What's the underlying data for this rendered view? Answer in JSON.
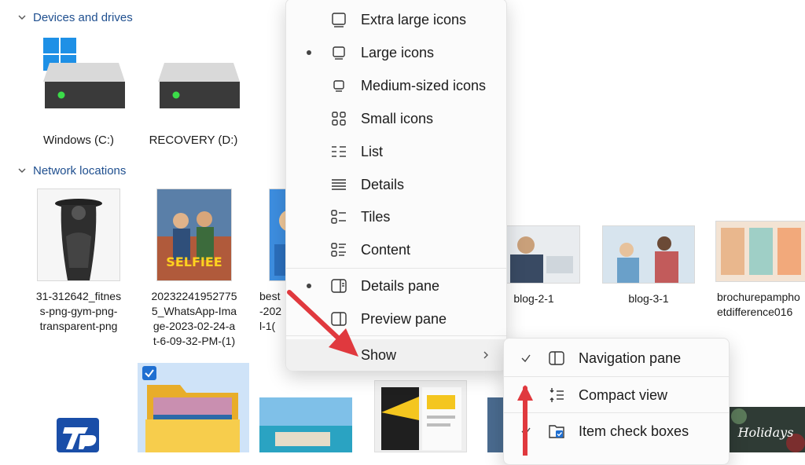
{
  "sections": {
    "devices": "Devices and drives",
    "network": "Network locations"
  },
  "drives": [
    {
      "label": "Windows (C:)"
    },
    {
      "label": "RECOVERY (D:)"
    }
  ],
  "files_row1": [
    {
      "name_lines": [
        "31-312642_fitnes",
        "s-png-gym-png-",
        "transparent-png"
      ]
    },
    {
      "name_lines": [
        "20232241952775",
        "5_WhatsApp-Ima",
        "ge-2023-02-24-a",
        "t-6-09-32-PM-(1)"
      ],
      "thumb_text": "SELFIEE"
    },
    {
      "name_lines": [
        "best",
        "-202",
        "l-1("
      ]
    },
    {
      "name_lines": [
        "blog-2-1"
      ]
    },
    {
      "name_lines": [
        "blog-3-1"
      ]
    },
    {
      "name_lines": [
        "brochurepampho",
        "etdifference016"
      ]
    }
  ],
  "bottom_thumbs": {
    "holidays_text": "Holidays"
  },
  "view_menu": {
    "items": [
      {
        "label": "Extra large icons",
        "icon": "extra-large-icons-icon"
      },
      {
        "label": "Large icons",
        "icon": "large-icons-icon",
        "selected": true
      },
      {
        "label": "Medium-sized icons",
        "icon": "medium-icons-icon"
      },
      {
        "label": "Small icons",
        "icon": "small-icons-icon"
      },
      {
        "label": "List",
        "icon": "list-icon"
      },
      {
        "label": "Details",
        "icon": "details-icon"
      },
      {
        "label": "Tiles",
        "icon": "tiles-icon"
      },
      {
        "label": "Content",
        "icon": "content-icon"
      },
      {
        "label": "Details pane",
        "icon": "details-pane-icon",
        "selected": true
      },
      {
        "label": "Preview pane",
        "icon": "preview-pane-icon"
      },
      {
        "label": "Show",
        "icon": "chevron-right-icon"
      }
    ]
  },
  "show_submenu": {
    "items": [
      {
        "label": "Navigation pane",
        "checked": true
      },
      {
        "label": "Compact view"
      },
      {
        "label": "Item check boxes",
        "checked": true
      }
    ]
  },
  "colors": {
    "accent": "#1f6fd1",
    "folder": "#f4c542",
    "arrow": "#e0393e"
  }
}
